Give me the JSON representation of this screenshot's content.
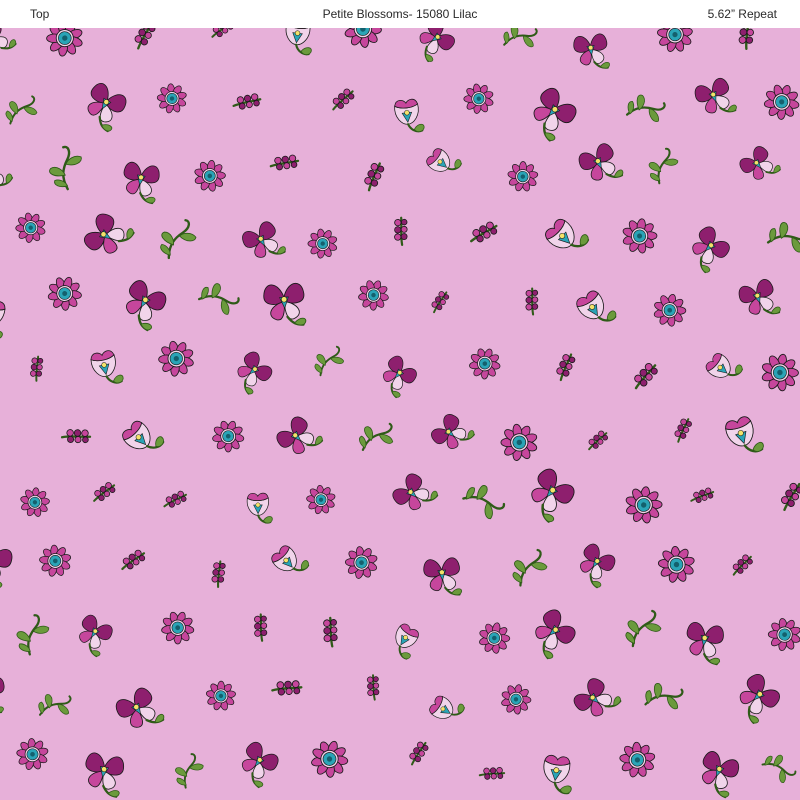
{
  "header": {
    "left_label": "Top",
    "title": "Petite Blossoms- 15080 Lilac",
    "repeat_label": "5.62” Repeat"
  },
  "colors": {
    "background": "#e7b0d9",
    "petal_dark": "#8e1f6e",
    "petal_mid": "#c6469c",
    "petal_light": "#f1d4ea",
    "center_teal": "#2aa4b6",
    "center_dark": "#14606d",
    "leaf": "#6b9a3c",
    "leaf_dark": "#2f5a18",
    "outline": "#1a1a1a"
  },
  "pattern": {
    "motifs": [
      "pansy-flower",
      "daisy-flower",
      "bud-cluster",
      "leaf-sprig",
      "bellflower"
    ]
  }
}
